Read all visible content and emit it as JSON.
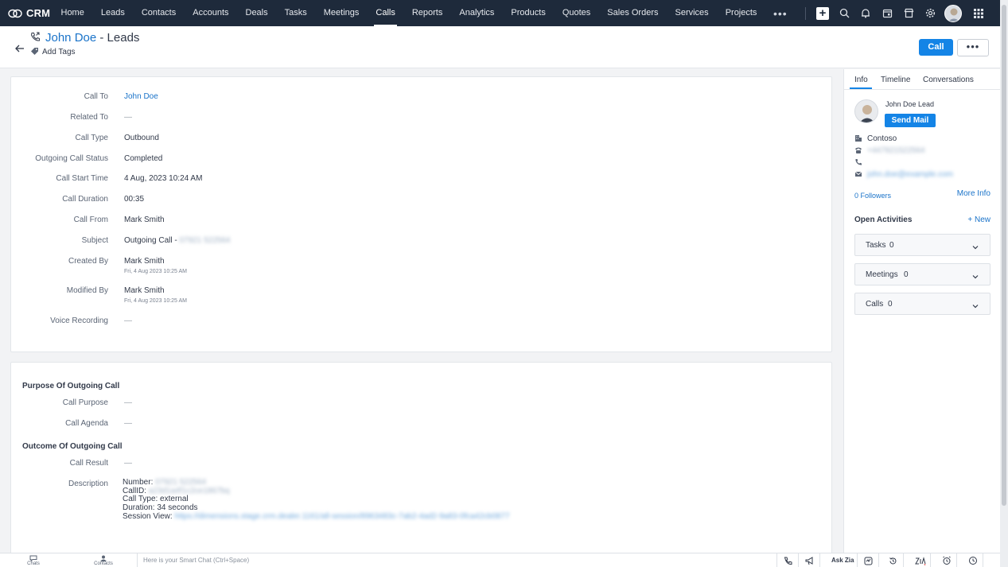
{
  "nav": {
    "brand": "CRM",
    "items": [
      "Home",
      "Leads",
      "Contacts",
      "Accounts",
      "Deals",
      "Tasks",
      "Meetings",
      "Calls",
      "Reports",
      "Analytics",
      "Products",
      "Quotes",
      "Sales Orders",
      "Services",
      "Projects"
    ],
    "active": "Calls",
    "more": "•••"
  },
  "header": {
    "record_name": "John Doe",
    "module_suffix": " - Leads",
    "add_tags": "Add Tags",
    "call_button": "Call",
    "more_button": "•••"
  },
  "details": {
    "call_to_label": "Call To",
    "call_to": "John Doe",
    "related_to_label": "Related To",
    "related_to": "—",
    "call_type_label": "Call Type",
    "call_type": "Outbound",
    "status_label": "Outgoing Call Status",
    "status": "Completed",
    "start_label": "Call Start Time",
    "start": "4 Aug, 2023 10:24 AM",
    "duration_label": "Call Duration",
    "duration": "00:35",
    "from_label": "Call From",
    "from": "Mark Smith",
    "subject_label": "Subject",
    "subject_prefix": "Outgoing Call - ",
    "subject_blur": "07921 522564",
    "created_label": "Created By",
    "created_by": "Mark Smith",
    "created_at": "Fri, 4 Aug 2023 10:25 AM",
    "modified_label": "Modified By",
    "modified_by": "Mark Smith",
    "modified_at": "Fri, 4 Aug 2023 10:25 AM",
    "voice_label": "Voice Recording",
    "voice": "—"
  },
  "purpose": {
    "section_title": "Purpose Of Outgoing Call",
    "purpose_label": "Call Purpose",
    "purpose": "—",
    "agenda_label": "Call Agenda",
    "agenda": "—"
  },
  "outcome": {
    "section_title": "Outcome Of Outgoing Call",
    "result_label": "Call Result",
    "result": "—",
    "description_label": "Description",
    "number_prefix": "Number: ",
    "number_blur": "07921 522564",
    "callid_prefix": "CallID: ",
    "callid_blur": "a23d1a4f1c2ce1867bq",
    "call_type_line": "Call Type: external",
    "duration_line": "Duration: 34 seconds",
    "session_prefix": "Session View: ",
    "session_blur": "https://dimensions.stage.crm.dealer.1161/all-session/8963483c-7ab2-4ad2-9a83-0fca42cb0877"
  },
  "sidebar": {
    "tabs": [
      "Info",
      "Timeline",
      "Conversations"
    ],
    "lead_name": "John Doe Lead",
    "send_mail": "Send Mail",
    "company": "Contoso",
    "phone_blur": "+447921522564",
    "mobile": "",
    "email_blur": "john.doe@example.com",
    "followers": "0 Followers",
    "more_info": "More Info",
    "open_activities": "Open Activities",
    "new": "+ New",
    "activities": [
      {
        "label": "Tasks",
        "count": "0"
      },
      {
        "label": "Meetings",
        "count": "0"
      },
      {
        "label": "Calls",
        "count": "0"
      }
    ]
  },
  "bottom": {
    "chats": "Chats",
    "contacts": "Contacts",
    "smart_chat": "Here is your Smart Chat (Ctrl+Space)",
    "ask_zia": "Ask Zia"
  }
}
